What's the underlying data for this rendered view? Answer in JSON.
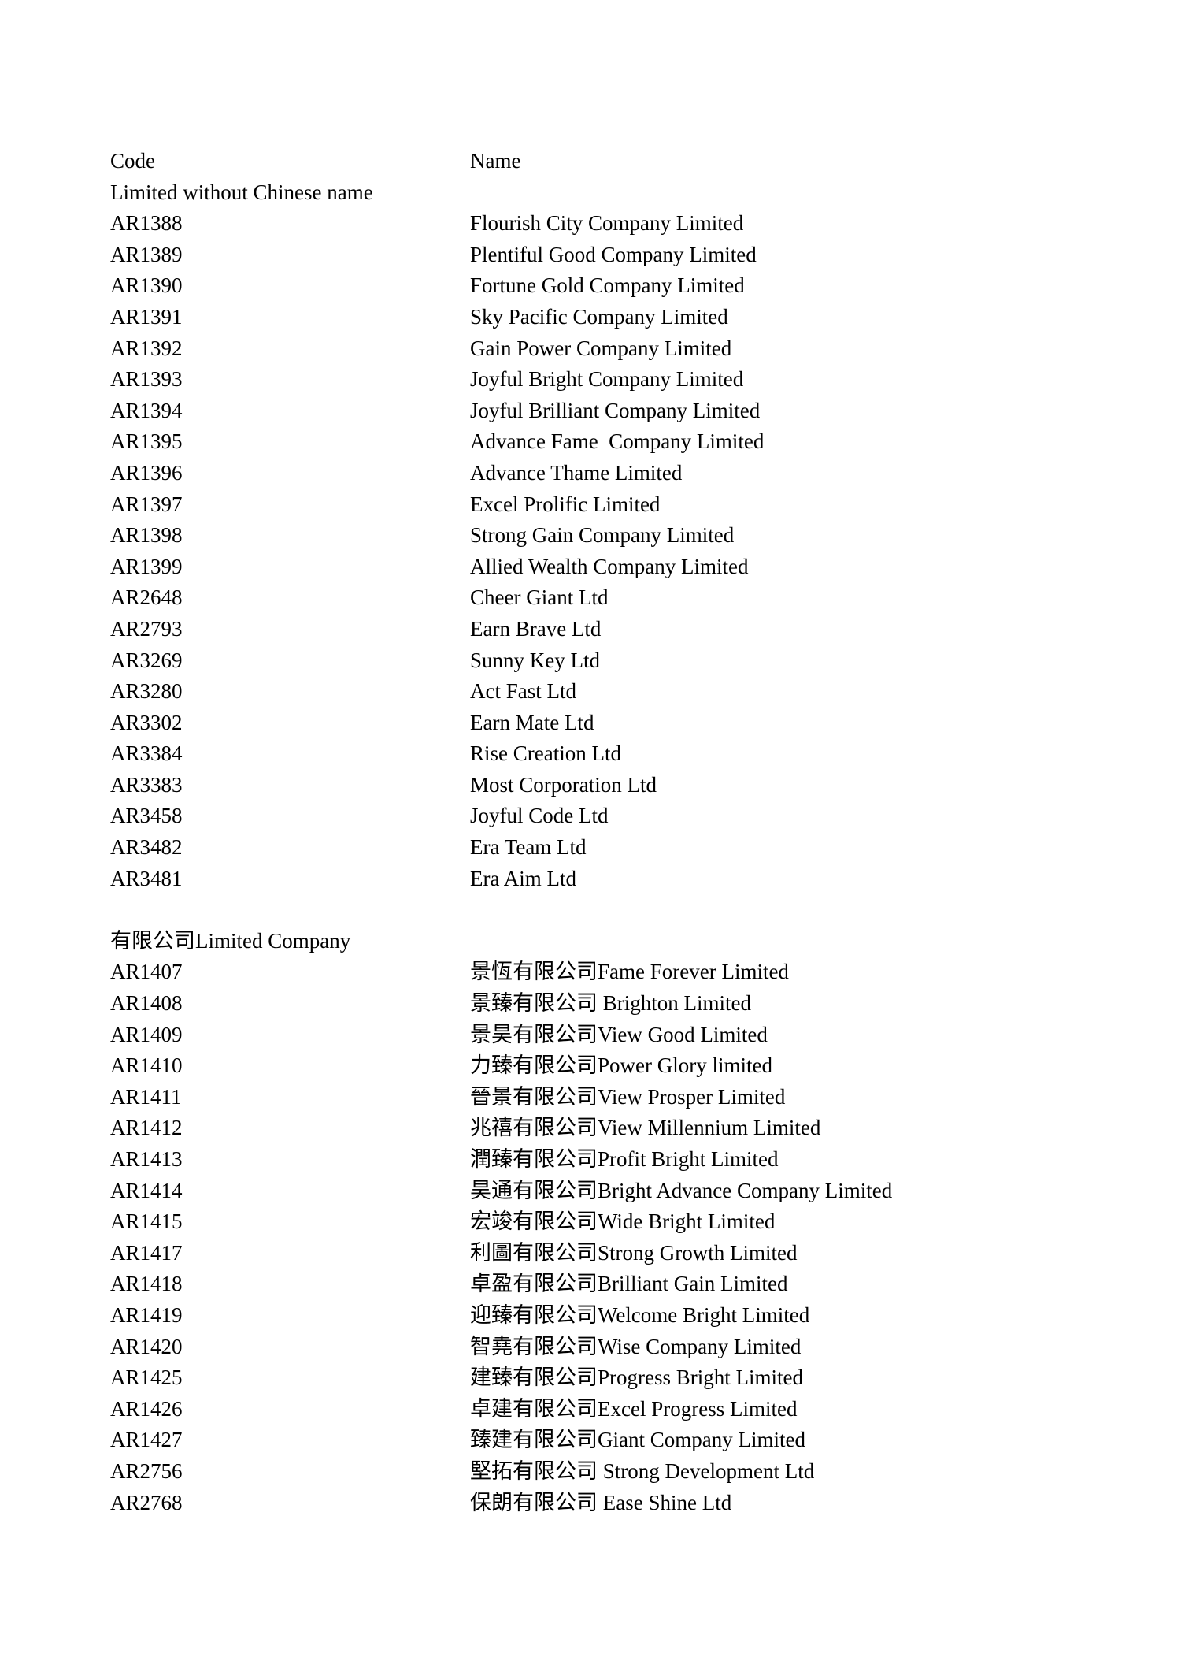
{
  "document": {
    "columns": {
      "code_header": "Code",
      "name_header": "Name"
    },
    "sections": [
      {
        "heading": "Limited without Chinese name",
        "rows": [
          {
            "code": "AR1388",
            "name": "Flourish City Company Limited"
          },
          {
            "code": "AR1389",
            "name": "Plentiful Good Company Limited"
          },
          {
            "code": "AR1390",
            "name": "Fortune Gold Company Limited"
          },
          {
            "code": "AR1391",
            "name": "Sky Pacific Company Limited"
          },
          {
            "code": "AR1392",
            "name": "Gain Power Company Limited"
          },
          {
            "code": "AR1393",
            "name": "Joyful Bright Company Limited"
          },
          {
            "code": "AR1394",
            "name": "Joyful Brilliant Company Limited"
          },
          {
            "code": "AR1395",
            "name": "Advance Fame  Company Limited"
          },
          {
            "code": "AR1396",
            "name": "Advance Thame Limited"
          },
          {
            "code": "AR1397",
            "name": "Excel Prolific Limited"
          },
          {
            "code": "AR1398",
            "name": "Strong Gain Company Limited"
          },
          {
            "code": "AR1399",
            "name": "Allied Wealth Company Limited"
          },
          {
            "code": "AR2648",
            "name": "Cheer Giant Ltd"
          },
          {
            "code": "AR2793",
            "name": "Earn Brave Ltd"
          },
          {
            "code": "AR3269",
            "name": "Sunny Key Ltd"
          },
          {
            "code": "AR3280",
            "name": "Act Fast Ltd"
          },
          {
            "code": "AR3302",
            "name": "Earn Mate Ltd"
          },
          {
            "code": "AR3384",
            "name": "Rise Creation Ltd"
          },
          {
            "code": "AR3383",
            "name": "Most Corporation Ltd"
          },
          {
            "code": "AR3458",
            "name": "Joyful Code Ltd"
          },
          {
            "code": "AR3482",
            "name": "Era Team Ltd"
          },
          {
            "code": "AR3481",
            "name": "Era Aim Ltd"
          }
        ]
      },
      {
        "heading": "有限公司Limited Company",
        "rows": [
          {
            "code": "AR1407",
            "name": "景恆有限公司Fame Forever Limited"
          },
          {
            "code": "AR1408",
            "name": "景臻有限公司 Brighton Limited"
          },
          {
            "code": "AR1409",
            "name": "景昊有限公司View Good Limited"
          },
          {
            "code": "AR1410",
            "name": "力臻有限公司Power Glory limited"
          },
          {
            "code": "AR1411",
            "name": "晉景有限公司View Prosper Limited"
          },
          {
            "code": "AR1412",
            "name": "兆禧有限公司View Millennium Limited"
          },
          {
            "code": "AR1413",
            "name": "潤臻有限公司Profit Bright Limited"
          },
          {
            "code": "AR1414",
            "name": "昊通有限公司Bright Advance Company Limited"
          },
          {
            "code": "AR1415",
            "name": "宏竣有限公司Wide Bright Limited"
          },
          {
            "code": "AR1417",
            "name": "利圖有限公司Strong Growth Limited"
          },
          {
            "code": "AR1418",
            "name": "卓盈有限公司Brilliant Gain Limited"
          },
          {
            "code": "AR1419",
            "name": "迎臻有限公司Welcome Bright Limited"
          },
          {
            "code": "AR1420",
            "name": "智堯有限公司Wise Company Limited"
          },
          {
            "code": "AR1425",
            "name": "建臻有限公司Progress Bright Limited"
          },
          {
            "code": "AR1426",
            "name": "卓建有限公司Excel Progress Limited"
          },
          {
            "code": "AR1427",
            "name": "臻建有限公司Giant Company Limited"
          },
          {
            "code": "AR2756",
            "name": "堅拓有限公司 Strong Development Ltd"
          },
          {
            "code": "AR2768",
            "name": "保朗有限公司 Ease Shine Ltd"
          }
        ]
      }
    ]
  }
}
